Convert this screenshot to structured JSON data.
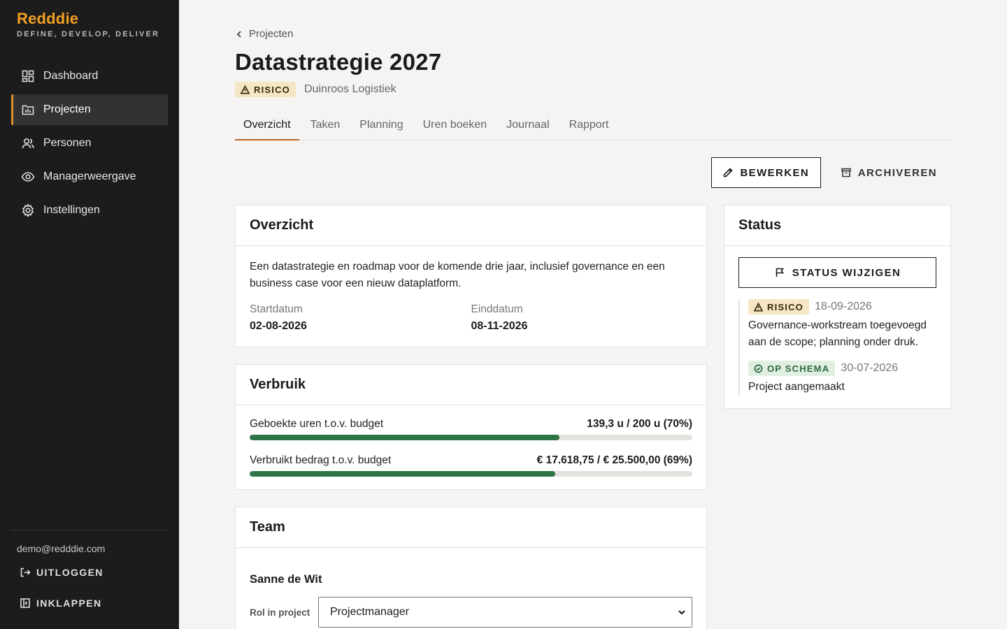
{
  "app": {
    "name": "Redddie",
    "tagline": "DEFINE, DEVELOP, DELIVER"
  },
  "sidebar": {
    "items": [
      {
        "label": "Dashboard",
        "icon": "dashboard-icon"
      },
      {
        "label": "Projecten",
        "icon": "projects-icon",
        "active": true
      },
      {
        "label": "Personen",
        "icon": "people-icon"
      },
      {
        "label": "Managerweergave",
        "icon": "eye-icon"
      },
      {
        "label": "Instellingen",
        "icon": "gear-icon"
      }
    ],
    "user_email": "demo@redddie.com",
    "logout_label": "UITLOGGEN",
    "collapse_label": "INKLAPPEN"
  },
  "breadcrumb": {
    "label": "Projecten"
  },
  "project": {
    "title": "Datastrategie 2027",
    "status_badge": "RISICO",
    "client": "Duinroos Logistiek"
  },
  "tabs": [
    "Overzicht",
    "Taken",
    "Planning",
    "Uren boeken",
    "Journaal",
    "Rapport"
  ],
  "actions": {
    "edit_label": "BEWERKEN",
    "archive_label": "ARCHIVEREN"
  },
  "overview": {
    "heading": "Overzicht",
    "description": "Een datastrategie en roadmap voor de komende drie jaar, inclusief governance en een business case voor een nieuw dataplatform.",
    "start_label": "Startdatum",
    "start_value": "02-08-2026",
    "end_label": "Einddatum",
    "end_value": "08-11-2026"
  },
  "usage": {
    "heading": "Verbruik",
    "hours_label": "Geboekte uren t.o.v. budget",
    "hours_value": "139,3 u / 200 u (70%)",
    "hours_fraction": 0.7,
    "amount_label": "Verbruikt bedrag t.o.v. budget",
    "amount_value": "€ 17.618,75 / € 25.500,00 (69%)",
    "amount_fraction": 0.69
  },
  "team": {
    "heading": "Team",
    "member_name": "Sanne de Wit",
    "role_label": "Rol in project",
    "role_value": "Projectmanager"
  },
  "status": {
    "heading": "Status",
    "change_label": "STATUS WIJZIGEN",
    "entries": [
      {
        "badge": "RISICO",
        "date": "18-09-2026",
        "text": "Governance-workstream toegevoegd aan de scope; planning onder druk."
      },
      {
        "badge": "OP SCHEMA",
        "date": "30-07-2026",
        "text": "Project aangemaakt"
      }
    ]
  },
  "colors": {
    "accent": "#f0a020",
    "tab_underline": "#c0642a",
    "progress": "#2e7447",
    "risk_bg": "#f5e6c4",
    "ok_bg": "#e1efe3"
  }
}
